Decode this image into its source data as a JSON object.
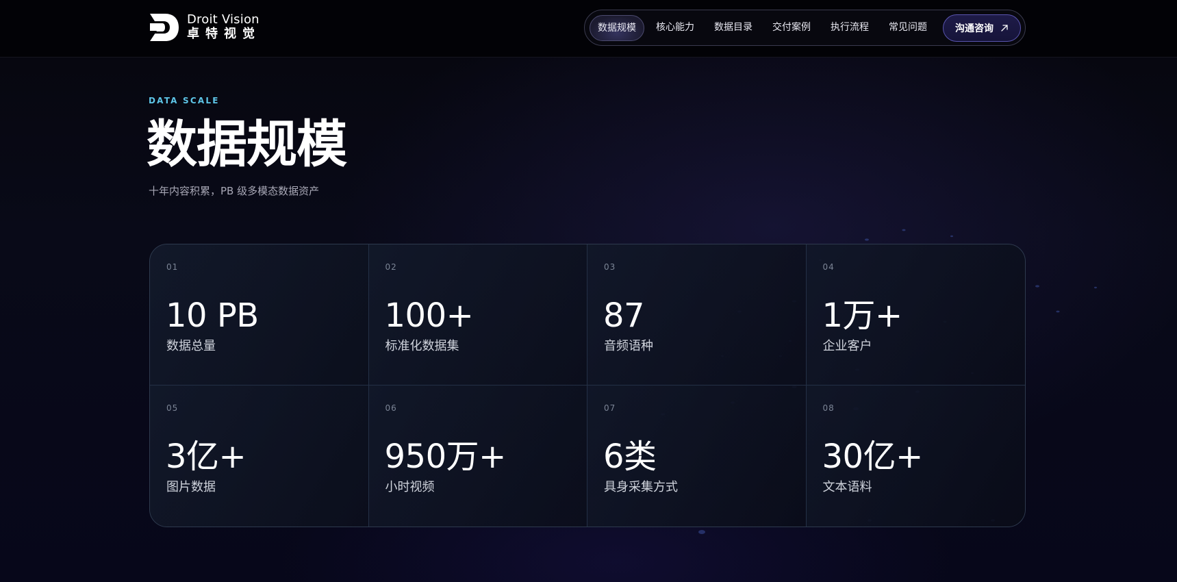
{
  "brand": {
    "name_en": "Droit Vision",
    "name_cn": "卓特视觉",
    "logo_icon": "droit-d-logo"
  },
  "nav": {
    "items": [
      {
        "label": "数据规模",
        "active": true
      },
      {
        "label": "核心能力",
        "active": false
      },
      {
        "label": "数据目录",
        "active": false
      },
      {
        "label": "交付案例",
        "active": false
      },
      {
        "label": "执行流程",
        "active": false
      },
      {
        "label": "常见问题",
        "active": false
      }
    ],
    "cta_label": "沟通咨询",
    "cta_icon": "arrow-up-right-icon"
  },
  "section": {
    "eyebrow": "DATA SCALE",
    "title": "数据规模",
    "subtitle": "十年内容积累，PB 级多模态数据资产"
  },
  "stats": [
    {
      "index": "01",
      "value": "10 PB",
      "label": "数据总量"
    },
    {
      "index": "02",
      "value": "100+",
      "label": "标准化数据集"
    },
    {
      "index": "03",
      "value": "87",
      "label": "音频语种"
    },
    {
      "index": "04",
      "value": "1万+",
      "label": "企业客户"
    },
    {
      "index": "05",
      "value": "3亿+",
      "label": "图片数据"
    },
    {
      "index": "06",
      "value": "950万+",
      "label": "小时视频"
    },
    {
      "index": "07",
      "value": "6类",
      "label": "具身采集方式"
    },
    {
      "index": "08",
      "value": "30亿+",
      "label": "文本语料"
    }
  ],
  "colors": {
    "accent": "#5ec6e8",
    "cta_border": "#5a55b0",
    "background": "#04040b"
  }
}
